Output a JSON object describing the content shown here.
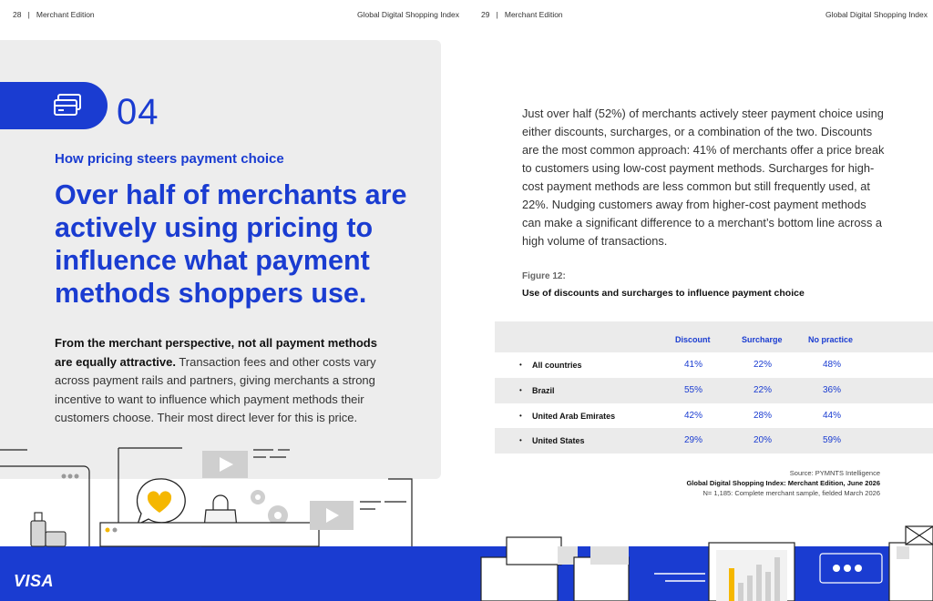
{
  "header": {
    "left_page": "28",
    "left_edition": "Merchant Edition",
    "left_report": "Global Digital Shopping Index",
    "right_page": "29",
    "right_edition": "Merchant Edition",
    "right_report": "Global Digital Shopping Index",
    "separator": "|"
  },
  "section": {
    "number": "04",
    "icon": "credit-card-icon",
    "kicker": "How pricing steers payment choice",
    "headline": "Over half of merchants are actively using pricing to influence what payment methods shoppers use.",
    "intro_bold": "From the merchant perspective, not all payment methods are equally attractive.",
    "intro_rest": " Transaction fees and other costs vary across payment rails and partners, giving merchants a strong incentive to want to influence which payment methods their customers choose. Their most direct lever for this is price."
  },
  "body": {
    "paragraph": "Just over half (52%) of merchants actively steer payment choice using either discounts, surcharges, or a combination of the two. Discounts are the most common approach: 41% of merchants offer a price break to customers using low-cost payment methods. Surcharges for high-cost payment methods are less common but still frequently used, at 22%. Nudging customers away from higher-cost payment methods can make a significant difference to a merchant’s bottom line across a high volume of transactions."
  },
  "figure": {
    "label": "Figure 12:",
    "title": "Use of discounts and surcharges to influence payment choice",
    "columns": [
      "Discount",
      "Surcharge",
      "No practice"
    ],
    "rows": [
      {
        "name": "All countries",
        "values": [
          "41%",
          "22%",
          "48%"
        ]
      },
      {
        "name": "Brazil",
        "values": [
          "55%",
          "22%",
          "36%"
        ]
      },
      {
        "name": "United Arab Emirates",
        "values": [
          "42%",
          "28%",
          "44%"
        ]
      },
      {
        "name": "United States",
        "values": [
          "29%",
          "20%",
          "59%"
        ]
      }
    ],
    "source_line1": "Source: PYMNTS Intelligence",
    "source_line2": "Global Digital Shopping Index: Merchant Edition, June 2026",
    "source_line3": "N= 1,185: Complete merchant sample, fielded March 2026"
  },
  "footer": {
    "brand": "VISA",
    "accent": "#1a3cd1"
  },
  "colors": {
    "accent_blue": "#1a3cd1",
    "panel_gray": "#ededed",
    "heart_yellow": "#f5b700"
  }
}
